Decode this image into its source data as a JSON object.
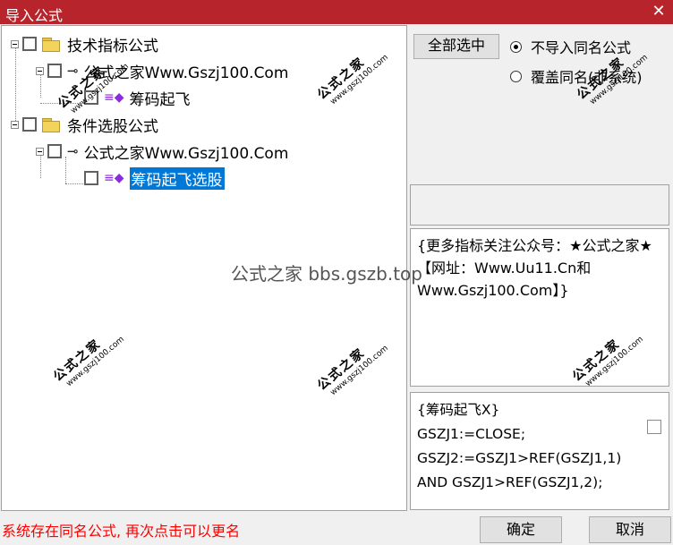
{
  "window": {
    "title": "导入公式",
    "close_glyph": "✕"
  },
  "tree": {
    "items": [
      {
        "label": "技术指标公式",
        "type": "folder"
      },
      {
        "label": "公式之家Www.Gszj100.Com",
        "type": "author"
      },
      {
        "label": "筹码起飞",
        "type": "formula"
      },
      {
        "label": "条件选股公式",
        "type": "folder"
      },
      {
        "label": "公式之家Www.Gszj100.Com",
        "type": "author"
      },
      {
        "label": "筹码起飞选股",
        "type": "formula",
        "selected": true
      }
    ]
  },
  "options": {
    "select_all_button": "全部选中",
    "radio_skip": "不导入同名公式",
    "radio_overwrite": "覆盖同名(非系统)",
    "selected_radio": "radio_skip"
  },
  "description": {
    "text": "{更多指标关注公众号：★公式之家★ 【网址：Www.Uu11.Cn和Www.Gszj100.Com】}"
  },
  "code": {
    "lines": [
      "{筹码起飞X}",
      "GSZJ1:=CLOSE;",
      "GSZJ2:=GSZJ1>REF(GSZJ1,1)",
      "AND GSZJ1>REF(GSZJ1,2);"
    ]
  },
  "status": {
    "message": "系统存在同名公式, 再次点击可以更名"
  },
  "buttons": {
    "ok": "确定",
    "cancel": "取消"
  },
  "watermark": {
    "stamp_text": "公式之家",
    "stamp_url": "www.gszj100.com",
    "center_text": "公式之家 bbs.gszb.top"
  },
  "colors": {
    "titlebar": "#b8242b",
    "status_text": "#ff0000",
    "selection": "#0078d7"
  }
}
